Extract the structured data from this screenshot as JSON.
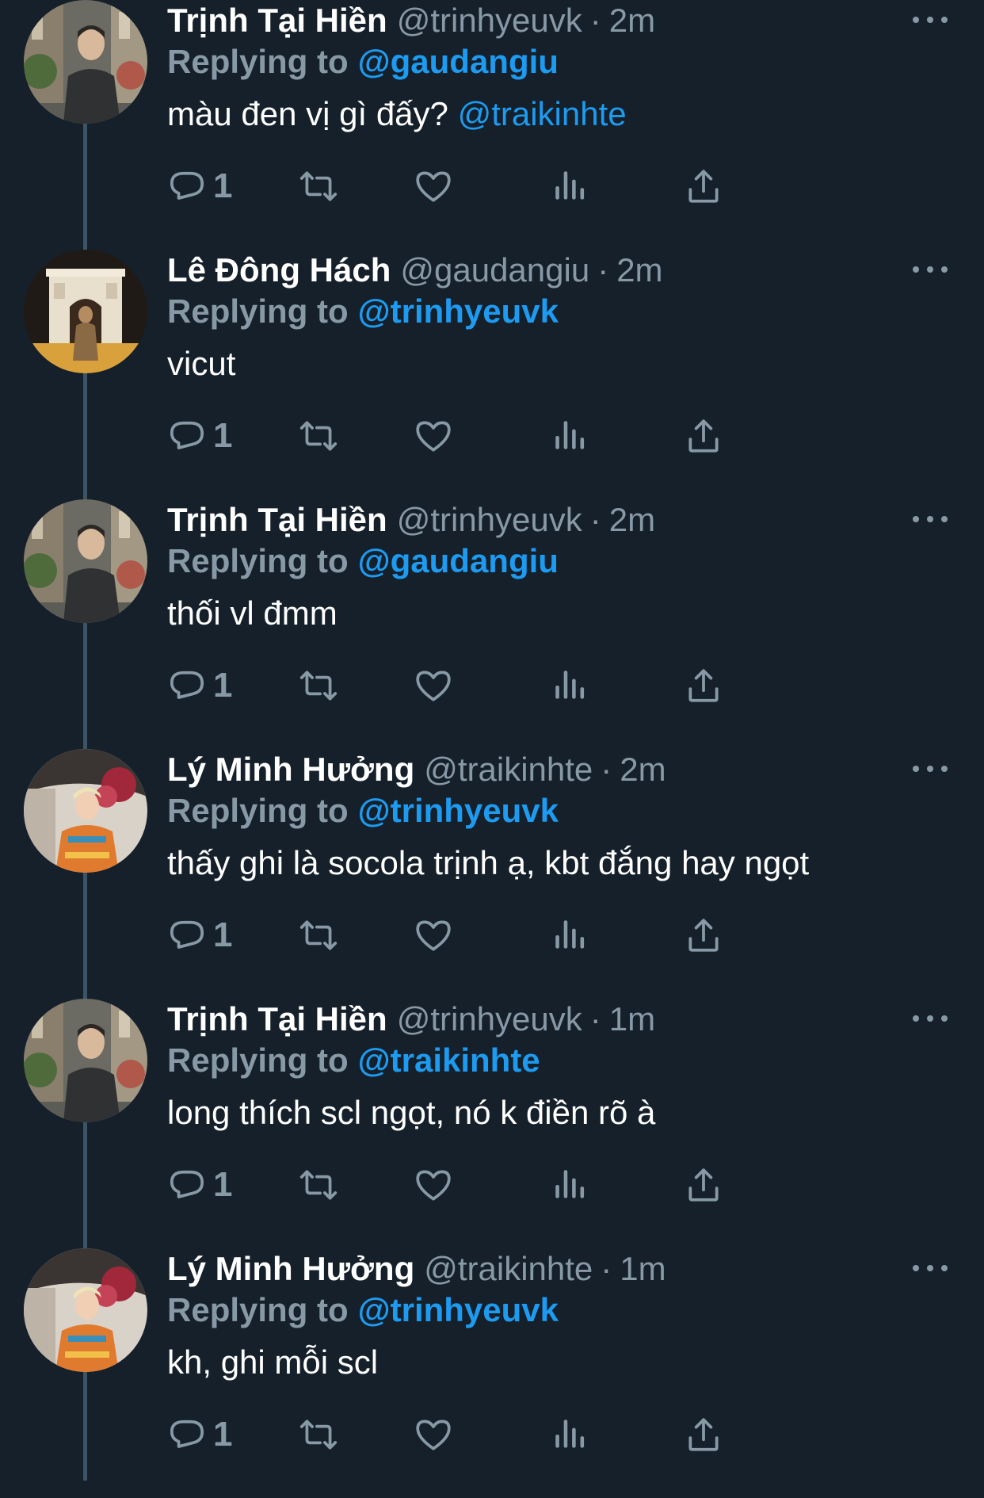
{
  "colors": {
    "background": "#15202b",
    "muted": "#8899a6",
    "accent": "#1d9bf0",
    "thread_line": "#3d5466"
  },
  "icons": [
    "reply-icon",
    "retweet-icon",
    "like-icon",
    "analytics-icon",
    "share-icon",
    "more-icon"
  ],
  "reply_label": "Replying to",
  "tweets": [
    {
      "name": "Trịnh Tại Hiền",
      "handle": "@trinhyeuvk",
      "dot": "·",
      "time": "2m",
      "replying_to": "@gaudangiu",
      "text": "màu đen vị gì đấy?",
      "mention": "@traikinhte",
      "reply_count": "1",
      "avatar": "man-street"
    },
    {
      "name": "Lê Đông Hách",
      "handle": "@gaudangiu",
      "dot": "·",
      "time": "2m",
      "replying_to": "@trinhyeuvk",
      "text": "vicut",
      "mention": "",
      "reply_count": "1",
      "avatar": "arch-night"
    },
    {
      "name": "Trịnh Tại Hiền",
      "handle": "@trinhyeuvk",
      "dot": "·",
      "time": "2m",
      "replying_to": "@gaudangiu",
      "text": "thối vl đmm",
      "mention": "",
      "reply_count": "1",
      "avatar": "man-street"
    },
    {
      "name": "Lý Minh Hưởng",
      "handle": "@traikinhte",
      "dot": "·",
      "time": "2m",
      "replying_to": "@trinhyeuvk",
      "text": "thấy ghi là socola trịnh ạ, kbt đắng hay ngọt",
      "mention": "",
      "reply_count": "1",
      "avatar": "car-flowers"
    },
    {
      "name": "Trịnh Tại Hiền",
      "handle": "@trinhyeuvk",
      "dot": "·",
      "time": "1m",
      "replying_to": "@traikinhte",
      "text": "long thích scl ngọt, nó k điền rõ à",
      "mention": "",
      "reply_count": "1",
      "avatar": "man-street"
    },
    {
      "name": "Lý Minh Hưởng",
      "handle": "@traikinhte",
      "dot": "·",
      "time": "1m",
      "replying_to": "@trinhyeuvk",
      "text": "kh, ghi mỗi scl",
      "mention": "",
      "reply_count": "1",
      "avatar": "car-flowers"
    }
  ]
}
